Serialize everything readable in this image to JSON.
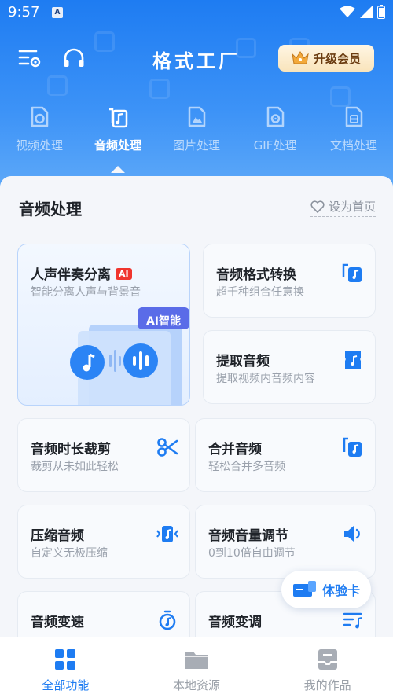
{
  "status_bar": {
    "time": "9:57",
    "app_icon_letter": "A"
  },
  "header": {
    "title": "格式工厂",
    "vip_label": "升级会员"
  },
  "category_tabs": [
    {
      "label": "视频处理",
      "icon": "video-icon",
      "active": false
    },
    {
      "label": "音频处理",
      "icon": "audio-file-icon",
      "active": true
    },
    {
      "label": "图片处理",
      "icon": "image-icon",
      "active": false
    },
    {
      "label": "GIF处理",
      "icon": "gif-icon",
      "active": false
    },
    {
      "label": "文档处理",
      "icon": "document-icon",
      "active": false
    }
  ],
  "panel": {
    "title": "音频处理",
    "homepage_label": "设为首页"
  },
  "featured": {
    "title": "人声伴奏分离",
    "badge": "AI",
    "subtitle": "智能分离人声与背景音",
    "tag": "AI智能"
  },
  "tools": [
    {
      "title": "音频格式转换",
      "subtitle": "超千种组合任意换",
      "icon": "audio-convert-icon"
    },
    {
      "title": "提取音频",
      "subtitle": "提取视频内音频内容",
      "icon": "extract-audio-icon"
    },
    {
      "title": "音频时长裁剪",
      "subtitle": "裁剪从未如此轻松",
      "icon": "scissors-icon"
    },
    {
      "title": "合并音频",
      "subtitle": "轻松合并多音频",
      "icon": "merge-audio-icon"
    },
    {
      "title": "压缩音频",
      "subtitle": "自定义无极压缩",
      "icon": "compress-audio-icon"
    },
    {
      "title": "音频音量调节",
      "subtitle": "0到10倍自由调节",
      "icon": "volume-icon"
    },
    {
      "title": "音频变速",
      "subtitle": "",
      "icon": "speed-icon"
    },
    {
      "title": "音频变调",
      "subtitle": "",
      "icon": "pitch-icon"
    }
  ],
  "trial_card": {
    "label": "体验卡"
  },
  "bottom_nav": [
    {
      "label": "全部功能",
      "icon": "grid-icon",
      "active": true
    },
    {
      "label": "本地资源",
      "icon": "folder-icon",
      "active": false
    },
    {
      "label": "我的作品",
      "icon": "works-icon",
      "active": false
    }
  ],
  "colors": {
    "primary": "#1e7cf2",
    "vip_text": "#6b3c10",
    "ai_badge": "#f0352e"
  }
}
